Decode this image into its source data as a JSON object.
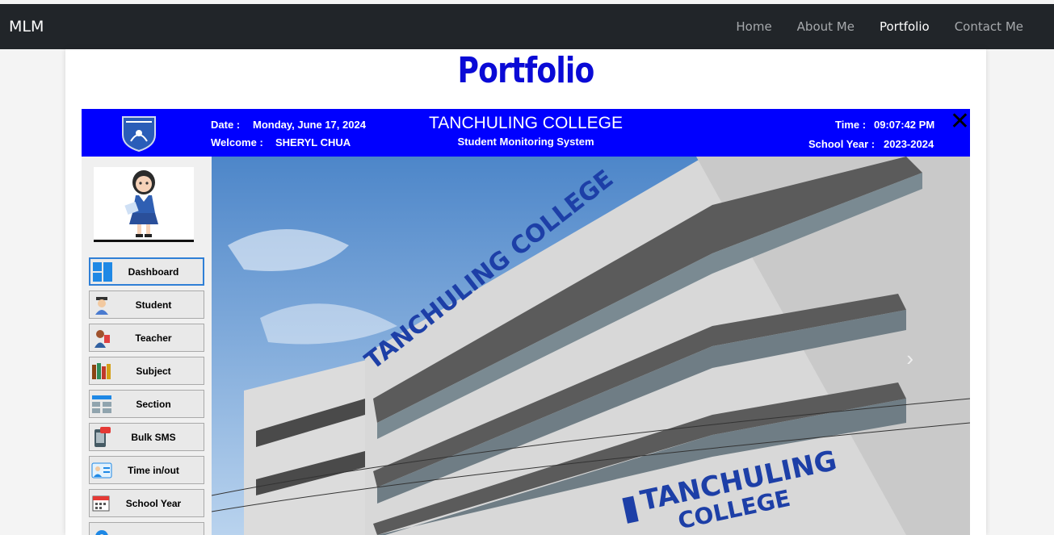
{
  "nav": {
    "brand": "MLM",
    "links": [
      "Home",
      "About Me",
      "Portfolio",
      "Contact Me"
    ],
    "active": "Portfolio"
  },
  "page": {
    "title": "Portfolio"
  },
  "app": {
    "date_label": "Date :",
    "date_value": "Monday, June 17, 2024",
    "welcome_label": "Welcome :",
    "welcome_value": "SHERYL CHUA",
    "college": "TANCHULING COLLEGE",
    "system": "Student Monitoring System",
    "time_label": "Time :",
    "time_value": "09:07:42 PM",
    "sy_label": "School Year :",
    "sy_value": "2023-2024",
    "close": "✕",
    "menu": [
      "Dashboard",
      "Student",
      "Teacher",
      "Subject",
      "Section",
      "Bulk SMS",
      "Time in/out",
      "School Year"
    ],
    "photo_sign": [
      "TANCHULING",
      "COLLEGE"
    ],
    "building_text": "TANCHULING COLLEGE"
  },
  "colors": {
    "navbar": "#212529",
    "title": "#0a0ad6",
    "app_header": "#0000ff"
  }
}
